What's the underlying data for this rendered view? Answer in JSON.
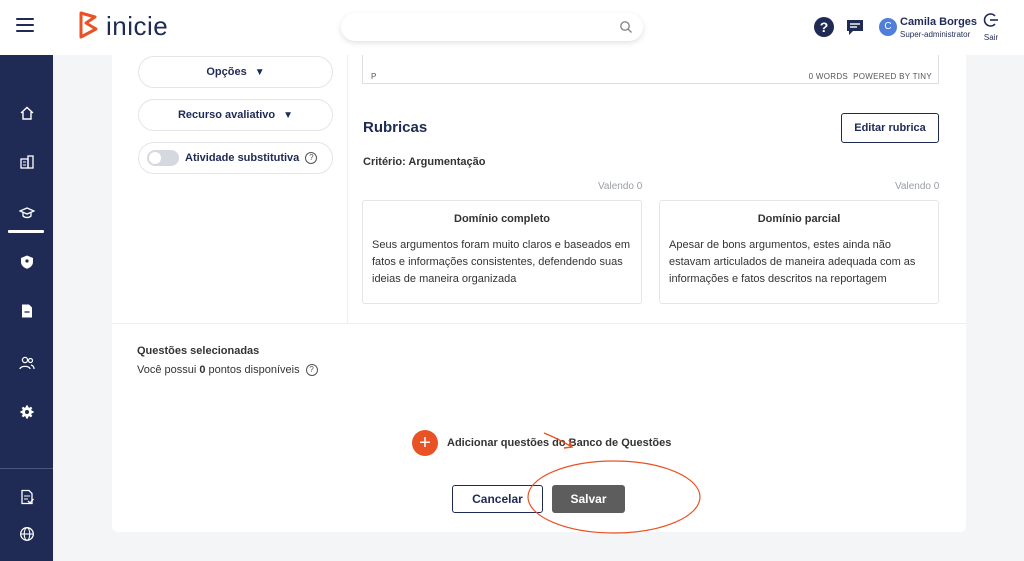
{
  "header": {
    "logo_text": "inicie",
    "search_placeholder": "",
    "help_label": "?",
    "user": {
      "initial": "C",
      "name": "Camila Borges",
      "role": "Super-administrator"
    },
    "logout_label": "Sair"
  },
  "colors": {
    "navy": "#1f2a55",
    "brand_orange": "#e85224",
    "avatar_blue": "#4f7fd9",
    "save_button": "#5d5d5d"
  },
  "sidebar": {
    "items": [
      {
        "icon": "home-icon"
      },
      {
        "icon": "building-icon"
      },
      {
        "icon": "graduation-cap-icon",
        "active": true
      },
      {
        "icon": "shield-icon"
      },
      {
        "icon": "document-icon"
      },
      {
        "icon": "users-icon"
      },
      {
        "icon": "gear-icon"
      },
      {
        "icon": "report-icon"
      },
      {
        "icon": "globe-icon"
      }
    ]
  },
  "left_panel": {
    "options_label": "Opções",
    "resource_label": "Recurso avaliativo",
    "substitute_label": "Atividade substitutiva",
    "substitute_enabled": false
  },
  "editor": {
    "status_path": "P",
    "word_count": "0 WORDS",
    "powered_by": "POWERED BY TINY"
  },
  "rubrics": {
    "title": "Rubricas",
    "edit_button": "Editar rubrica",
    "criterion": "Critério: Argumentação",
    "domains": [
      {
        "worth": "Valendo 0",
        "title": "Domínio completo",
        "description": "Seus argumentos foram muito claros e baseados em fatos e informações consistentes, defendendo suas ideias de maneira organizada"
      },
      {
        "worth": "Valendo 0",
        "title": "Domínio parcial",
        "description": "Apesar de bons argumentos, estes ainda não estavam articulados de maneira adequada com as informações e fatos descritos na reportagem"
      }
    ]
  },
  "questions": {
    "title": "Questões selecionadas",
    "points_prefix": "Você possui",
    "points_value": "0",
    "points_suffix": "pontos disponíveis",
    "add_label": "Adicionar questões do Banco de Questões"
  },
  "actions": {
    "cancel": "Cancelar",
    "save": "Salvar"
  }
}
